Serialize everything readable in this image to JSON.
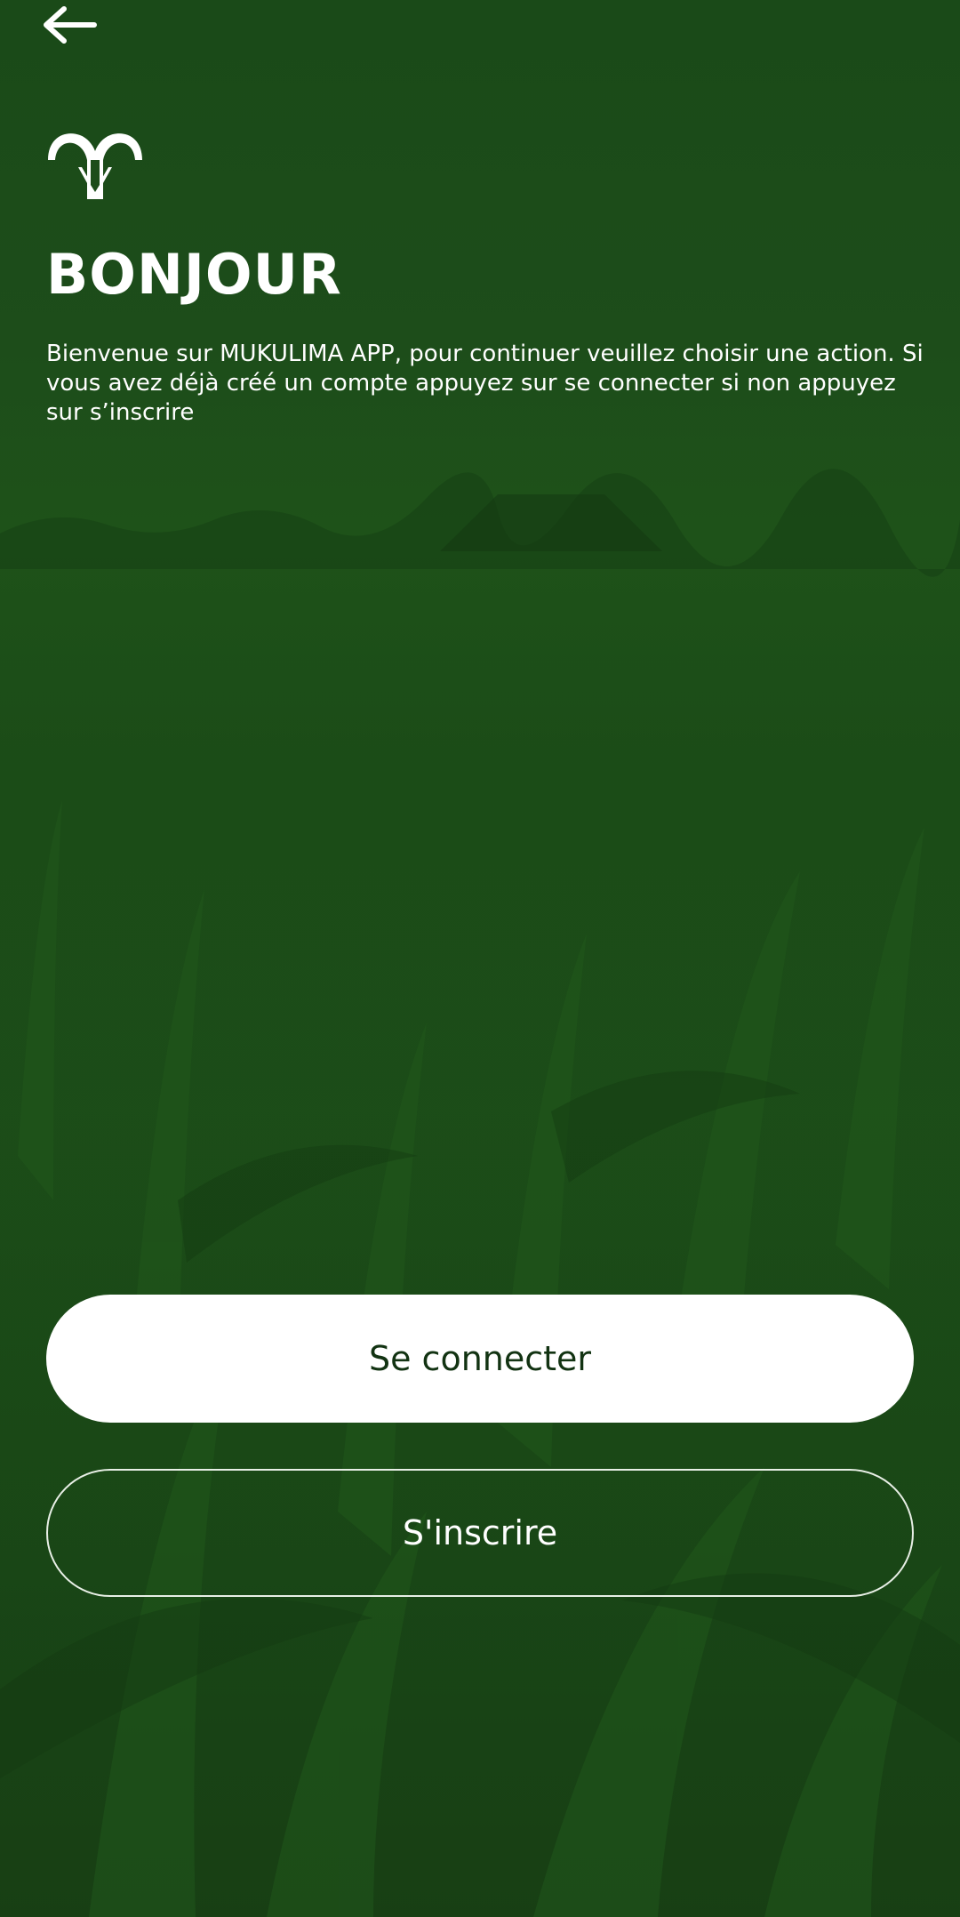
{
  "header": {
    "back_icon": "arrow-left-icon",
    "logo_icon": "mukulima-logo"
  },
  "welcome": {
    "title": "BONJOUR",
    "description": "Bienvenue sur MUKULIMA APP, pour continuer veuillez choisir une action. Si vous avez déjà créé un compte appuyez sur se connecter si non appuyez sur s’inscrire"
  },
  "actions": {
    "login_label": "Se connecter",
    "register_label": "S'inscrire"
  },
  "colors": {
    "background": "#1c4d18",
    "primary_button_bg": "#ffffff",
    "primary_button_text": "#123312",
    "secondary_button_border": "#e8efe6",
    "text": "#ffffff"
  }
}
